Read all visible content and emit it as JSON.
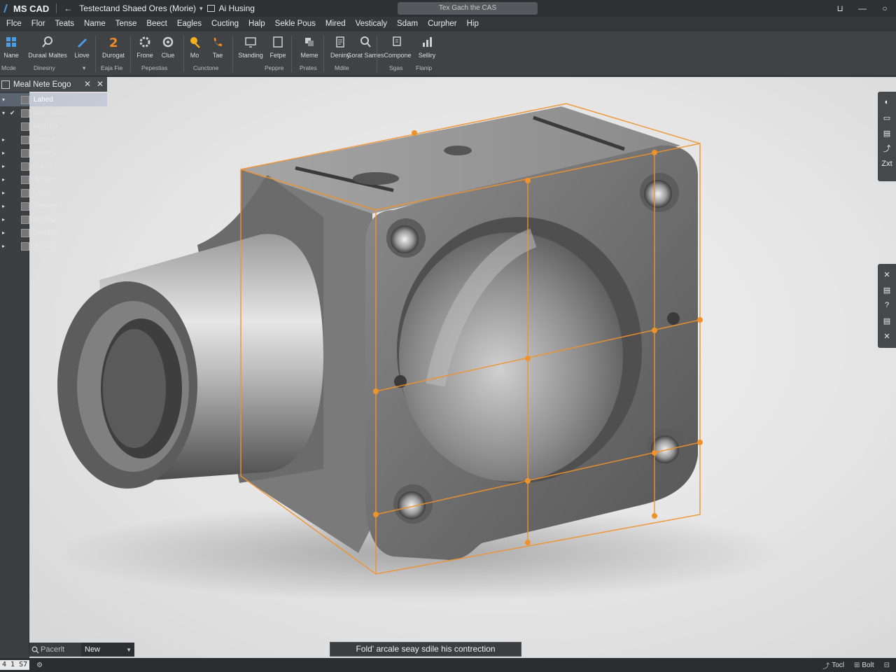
{
  "window": {
    "app_name": "MS CAD",
    "back_label": "←",
    "document_title": "Testectand Shaed Ores (Morie)",
    "document_caret": "▾",
    "workspace_title": "Ai Husing",
    "search_placeholder": "Tex Gach the CAS",
    "controls": [
      "⊔",
      "—",
      "○"
    ]
  },
  "menu": [
    "Flce",
    "Flor",
    "Teats",
    "Name",
    "Tense",
    "Beect",
    "Eagles",
    "Cucting",
    "Halp",
    "Sekle Pous",
    "Mired",
    "Vesticaly",
    "Sdam",
    "Curpher",
    "Hip"
  ],
  "ribbon": {
    "buttons": [
      {
        "label": "Nane",
        "icon": "grid-icon",
        "color": "#4a9be8"
      },
      {
        "label": "Duraal Maltes",
        "icon": "search-icon",
        "color": "#cfcfcf"
      },
      {
        "label": "Liove",
        "icon": "pencil-icon",
        "color": "#4a9be8"
      },
      {
        "label": "Durogat",
        "icon": "two-icon",
        "color": "#f08a24"
      },
      {
        "label": "Frone",
        "icon": "gear-icon",
        "color": "#cfcfcf"
      },
      {
        "label": "Clue",
        "icon": "cog-icon",
        "color": "#cfcfcf"
      },
      {
        "label": "Mo",
        "icon": "bulb-icon",
        "color": "#f2b01e"
      },
      {
        "label": "Tae",
        "icon": "phone-icon",
        "color": "#f08a24"
      },
      {
        "label": "Standing",
        "icon": "monitor-icon",
        "color": "#cfcfcf"
      },
      {
        "label": "Fetpe",
        "icon": "square-icon",
        "color": "#cfcfcf"
      },
      {
        "label": "Meme",
        "icon": "layers-icon",
        "color": "#cfcfcf"
      },
      {
        "label": "Deniny",
        "icon": "document-icon",
        "color": "#cfcfcf"
      },
      {
        "label": "Gorat Sames",
        "icon": "magnifier-icon",
        "color": "#cfcfcf"
      },
      {
        "label": "Compone",
        "icon": "component-icon",
        "color": "#cfcfcf"
      },
      {
        "label": "Selliry",
        "icon": "bars-icon",
        "color": "#cfcfcf"
      }
    ],
    "groups": [
      "Mcde",
      "Dinesny",
      "▾",
      "Eaja Fie",
      "Pepestias",
      "Cunctone",
      "Peppre",
      "Prates",
      "Mdite",
      "Sgas",
      "Flanip"
    ]
  },
  "panel": {
    "title": "Meal Nete Eogo",
    "close_icons": [
      "✕",
      "✕"
    ],
    "tree": [
      {
        "label": "Lahed",
        "toggle": "▾",
        "check": "",
        "selected": true
      },
      {
        "label": "Sine Srines",
        "toggle": "▾",
        "check": "✔",
        "selected": false
      },
      {
        "label": "Masnes",
        "toggle": "",
        "check": "",
        "selected": false
      },
      {
        "label": "Lamne7",
        "toggle": "▸",
        "check": "",
        "selected": false
      },
      {
        "label": "Sactet1",
        "toggle": "▸",
        "check": "",
        "selected": false
      },
      {
        "label": "Marto 7",
        "toggle": "▸",
        "check": "",
        "selected": false
      },
      {
        "label": "Segary",
        "toggle": "▸",
        "check": "",
        "selected": false
      },
      {
        "label": "Caron",
        "toggle": "▸",
        "check": "",
        "selected": false
      },
      {
        "label": "Bessen",
        "toggle": "▸",
        "check": "",
        "selected": false
      },
      {
        "label": "Fnalage",
        "toggle": "▸",
        "check": "",
        "selected": false
      },
      {
        "label": "Seriens",
        "toggle": "▸",
        "check": "",
        "selected": false
      },
      {
        "label": "Acrtio5",
        "toggle": "▸",
        "check": "",
        "selected": false
      }
    ]
  },
  "viewport": {
    "accent_color": "#f0922a",
    "right_toolbar_top": [
      "◐",
      "▭",
      "▤",
      "⤴",
      "Zxt"
    ],
    "right_toolbar_mid": [
      "✕",
      "▤",
      "?",
      "▤",
      "✕"
    ],
    "search_label": "Pacerlt",
    "select_value": "New",
    "tooltip": "Fold' arcale seay sdile his contrection"
  },
  "status": {
    "coord": "4 1 S7",
    "settings_icon": "⚙",
    "right_items": [
      {
        "icon": "⤴",
        "label": "Tocl"
      },
      {
        "icon": "⊞",
        "label": "Bolt"
      },
      {
        "icon": "⊟",
        "label": ""
      }
    ]
  }
}
